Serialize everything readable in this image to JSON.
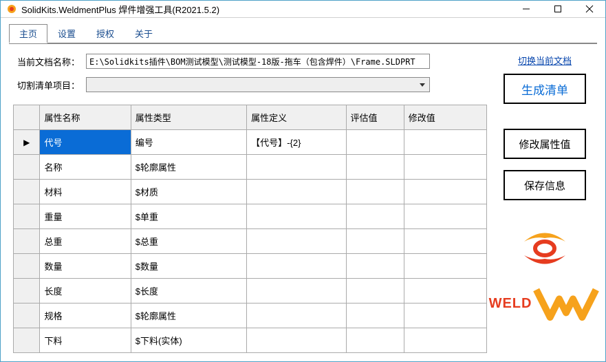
{
  "window": {
    "title": "SolidKits.WeldmentPlus 焊件增强工具(R2021.5.2)"
  },
  "tabs": [
    "主页",
    "设置",
    "授权",
    "关于"
  ],
  "form": {
    "docLabel": "当前文档名称：",
    "docPath": "E:\\Solidkits插件\\BOM测试模型\\测试模型-18版-拖车（包含焊件）\\Frame.SLDPRT",
    "cutLabel": "切割清单项目："
  },
  "table": {
    "headers": [
      "属性名称",
      "属性类型",
      "属性定义",
      "评估值",
      "修改值"
    ],
    "rows": [
      {
        "name": "代号",
        "type": "编号",
        "def": "【代号】-{2}",
        "eval": "",
        "mod": "",
        "selected": true
      },
      {
        "name": "名称",
        "type": "$轮廓属性",
        "def": "",
        "eval": "",
        "mod": ""
      },
      {
        "name": "材料",
        "type": "$材质",
        "def": "",
        "eval": "",
        "mod": ""
      },
      {
        "name": "重量",
        "type": "$单重",
        "def": "",
        "eval": "",
        "mod": ""
      },
      {
        "name": "总重",
        "type": "$总重",
        "def": "",
        "eval": "",
        "mod": ""
      },
      {
        "name": "数量",
        "type": "$数量",
        "def": "",
        "eval": "",
        "mod": ""
      },
      {
        "name": "长度",
        "type": "$长度",
        "def": "",
        "eval": "",
        "mod": ""
      },
      {
        "name": "规格",
        "type": "$轮廓属性",
        "def": "",
        "eval": "",
        "mod": ""
      },
      {
        "name": "下料",
        "type": "$下料(实体)",
        "def": "",
        "eval": "",
        "mod": ""
      }
    ]
  },
  "side": {
    "switchDoc": "切换当前文档",
    "generate": "生成清单",
    "modify": "修改属性值",
    "save": "保存信息",
    "logo": "WELD"
  }
}
